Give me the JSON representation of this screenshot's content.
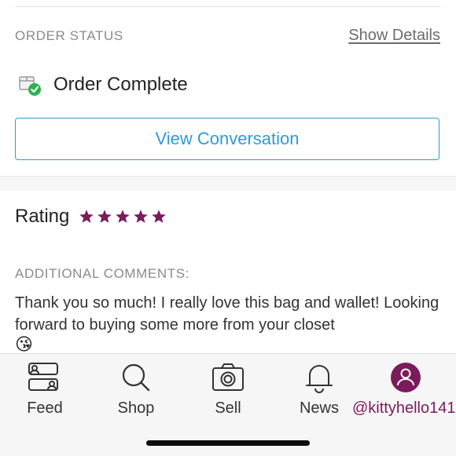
{
  "order_status": {
    "label": "ORDER STATUS",
    "details_link": "Show Details",
    "status_text": "Order Complete",
    "status_icon": "package-check-icon",
    "conversation_button": "View Conversation"
  },
  "rating": {
    "label": "Rating",
    "stars": 5,
    "star_color": "#7b1b5c"
  },
  "comments": {
    "label": "ADDITIONAL COMMENTS:",
    "text": "Thank you so much! I really love this bag and wallet! Looking forward to buying some more from your closet",
    "emoji": "😘"
  },
  "tabbar": {
    "items": [
      {
        "label": "Feed",
        "icon": "feed-icon"
      },
      {
        "label": "Shop",
        "icon": "search-icon"
      },
      {
        "label": "Sell",
        "icon": "camera-icon"
      },
      {
        "label": "News",
        "icon": "bell-icon"
      },
      {
        "label": "@kittyhello141",
        "icon": "avatar-icon",
        "active": true
      }
    ]
  },
  "colors": {
    "accent_blue": "#2e9bd6",
    "brand_magenta": "#7b1b5c",
    "success_green": "#2bb24c"
  }
}
